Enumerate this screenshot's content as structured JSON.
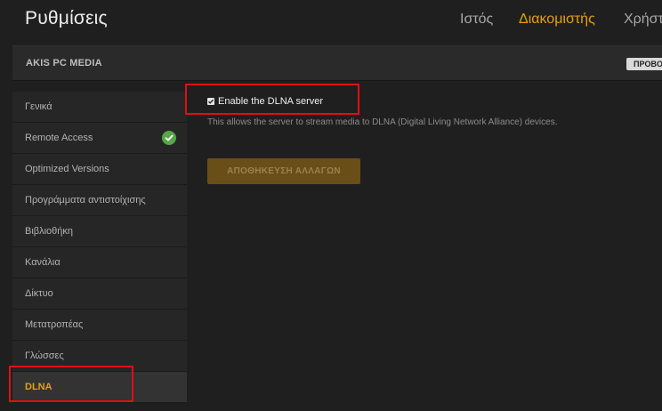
{
  "header": {
    "title": "Ρυθμίσεις",
    "tabs": [
      {
        "label": "Ιστός",
        "active": false
      },
      {
        "label": "Διακομιστής",
        "active": true
      },
      {
        "label": "Χρήστ",
        "active": false
      }
    ]
  },
  "server_bar": {
    "name": "AKIS PC MEDIA",
    "view_button_label": "ΠΡΟΒΟ"
  },
  "sidebar": {
    "items": [
      {
        "label": "Γενικά"
      },
      {
        "label": "Remote Access",
        "status_icon": "check-circle-icon"
      },
      {
        "label": "Optimized Versions"
      },
      {
        "label": "Προγράμματα αντιστοίχισης"
      },
      {
        "label": "Βιβλιοθήκη"
      },
      {
        "label": "Κανάλια"
      },
      {
        "label": "Δίκτυο"
      },
      {
        "label": "Μετατροπέας"
      },
      {
        "label": "Γλώσσες"
      },
      {
        "label": "DLNA",
        "active": true
      }
    ]
  },
  "main": {
    "dlna_option": {
      "label": "Enable the DLNA server",
      "checked": true,
      "help": "This allows the server to stream media to DLNA (Digital Living Network Alliance) devices."
    },
    "save_label": "ΑΠΟΘΗΚΕΥΣΗ ΑΛΛΑΓΩΝ"
  },
  "colors": {
    "accent": "#e5a00d",
    "background": "#1f1f1f",
    "sidebar": "#262626",
    "success": "#57a64a",
    "highlight": "#e01010"
  }
}
